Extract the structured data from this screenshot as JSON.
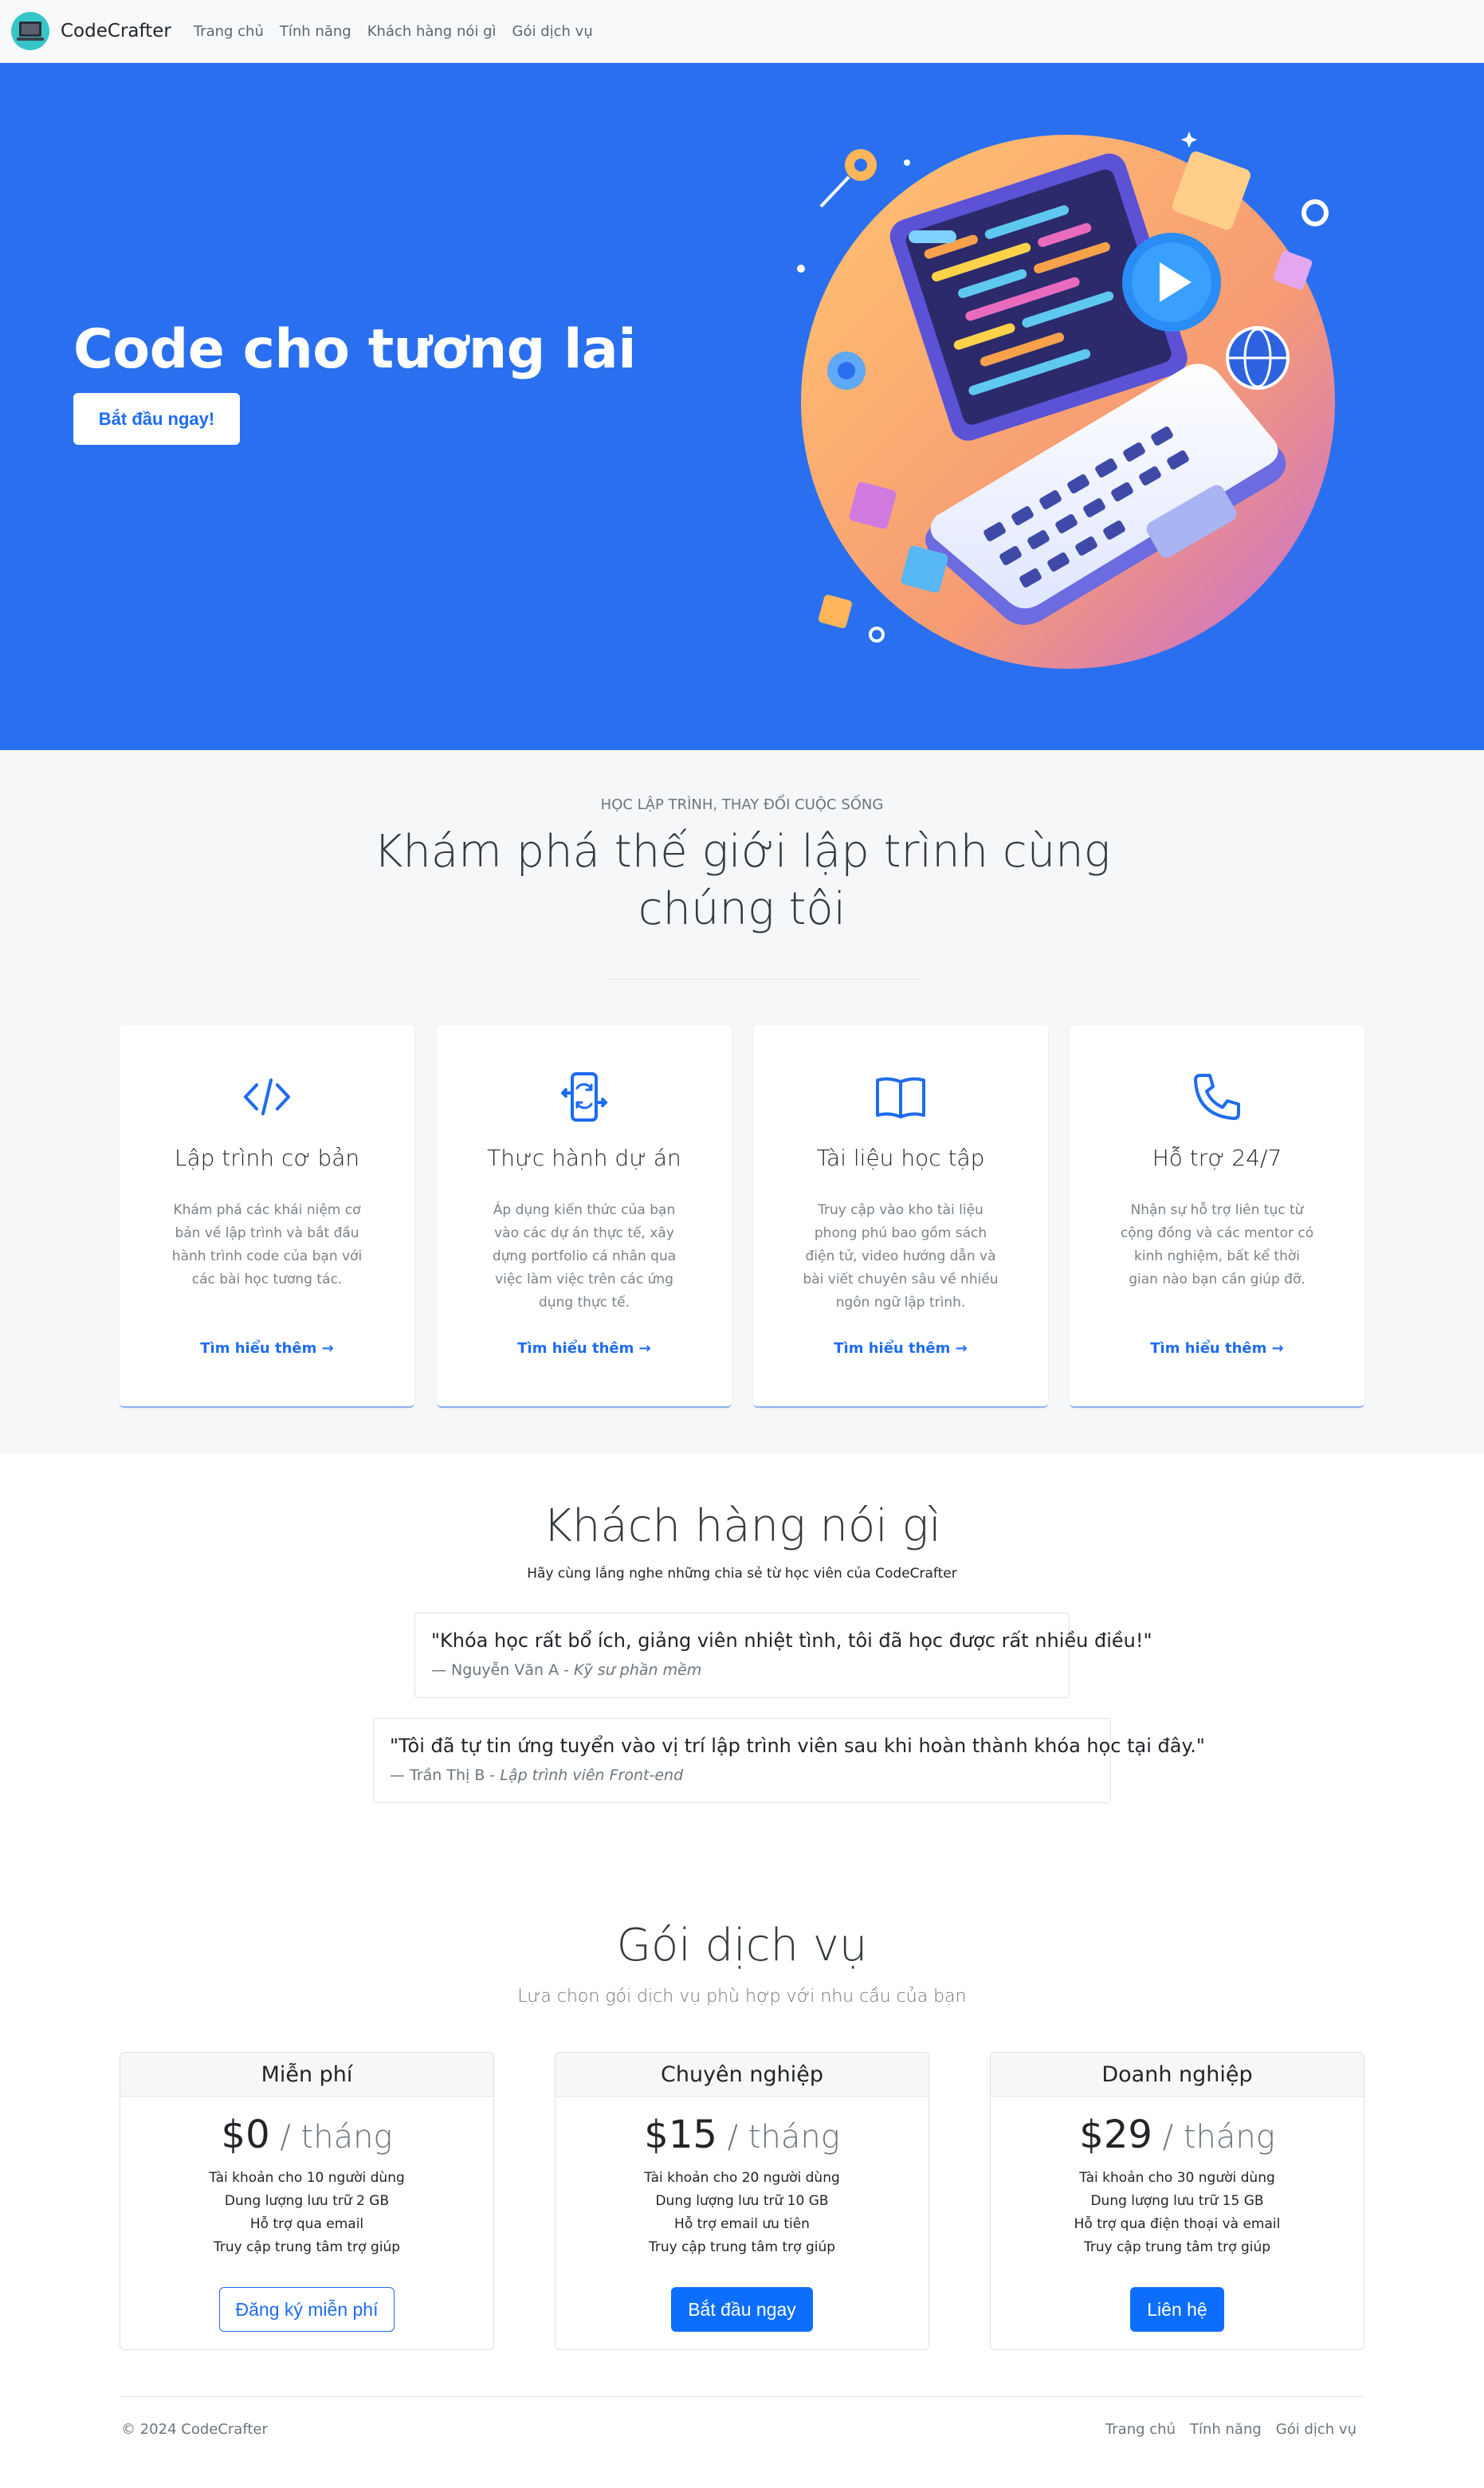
{
  "nav": {
    "brand": "CodeCrafter",
    "links": [
      "Trang chủ",
      "Tính năng",
      "Khách hàng nói gì",
      "Gói dịch vụ"
    ]
  },
  "hero": {
    "title": "Code cho tương lai",
    "button": "Bắt đầu ngay!"
  },
  "features": {
    "eyebrow": "HỌC LẬP TRÌNH, THAY ĐỔI CUỘC SỐNG",
    "title": "Khám phá thế giới lập trình cùng chúng tôi",
    "cards": [
      {
        "icon": "code-icon",
        "title": "Lập trình cơ bản",
        "desc": "Khám phá các khái niệm cơ bản về lập trình và bắt đầu hành trình code của bạn với các bài học tương tác.",
        "link": "Tìm hiểu thêm →"
      },
      {
        "icon": "mobile-sync-icon",
        "title": "Thực hành dự án",
        "desc": "Áp dụng kiến thức của bạn vào các dự án thực tế, xây dựng portfolio cá nhân qua việc làm việc trên các ứng dụng thực tế.",
        "link": "Tìm hiểu thêm →"
      },
      {
        "icon": "book-icon",
        "title": "Tài liệu học tập",
        "desc": "Truy cập vào kho tài liệu phong phú bao gồm sách điện tử, video hướng dẫn và bài viết chuyên sâu về nhiều ngôn ngữ lập trình.",
        "link": "Tìm hiểu thêm →"
      },
      {
        "icon": "phone-icon",
        "title": "Hỗ trợ 24/7",
        "desc": "Nhận sự hỗ trợ liên tục từ cộng đồng và các mentor có kinh nghiệm, bất kể thời gian nào bạn cần giúp đỡ.",
        "link": "Tìm hiểu thêm →"
      }
    ]
  },
  "testimonials": {
    "title": "Khách hàng nói gì",
    "subtitle": "Hãy cùng lắng nghe những chia sẻ từ học viên của CodeCrafter",
    "items": [
      {
        "quote": "\"Khóa học rất bổ ích, giảng viên nhiệt tình, tôi đã học được rất nhiều điều!\"",
        "author": "— Nguyễn Văn A -",
        "role": "Kỹ sư phần mềm"
      },
      {
        "quote": "\"Tôi đã tự tin ứng tuyển vào vị trí lập trình viên sau khi hoàn thành khóa học tại đây.\"",
        "author": "— Trần Thị B -",
        "role": "Lập trình viên Front-end"
      }
    ]
  },
  "pricing": {
    "title": "Gói dịch vụ",
    "subtitle": "Lựa chọn gói dịch vụ phù hợp với nhu cầu của bạn",
    "plans": [
      {
        "name": "Miễn phí",
        "price": "$0",
        "per": " / tháng",
        "features": [
          "Tài khoản cho 10 người dùng",
          "Dung lượng lưu trữ 2 GB",
          "Hỗ trợ qua email",
          "Truy cập trung tâm trợ giúp"
        ],
        "button": "Đăng ký miễn phí"
      },
      {
        "name": "Chuyên nghiệp",
        "price": "$15",
        "per": " / tháng",
        "features": [
          "Tài khoản cho 20 người dùng",
          "Dung lượng lưu trữ 10 GB",
          "Hỗ trợ email ưu tiên",
          "Truy cập trung tâm trợ giúp"
        ],
        "button": "Bắt đầu ngay"
      },
      {
        "name": "Doanh nghiệp",
        "price": "$29",
        "per": " / tháng",
        "features": [
          "Tài khoản cho 30 người dùng",
          "Dung lượng lưu trữ 15 GB",
          "Hỗ trợ qua điện thoại và email",
          "Truy cập trung tâm trợ giúp"
        ],
        "button": "Liên hệ"
      }
    ]
  },
  "footer": {
    "copyright": "© 2024 CodeCrafter",
    "links": [
      "Trang chủ",
      "Tính năng",
      "Gói dịch vụ"
    ]
  },
  "colors": {
    "hero_bg": "#2a6ff0",
    "accent": "#1e6cf0",
    "primary_button": "#0d6efd"
  }
}
